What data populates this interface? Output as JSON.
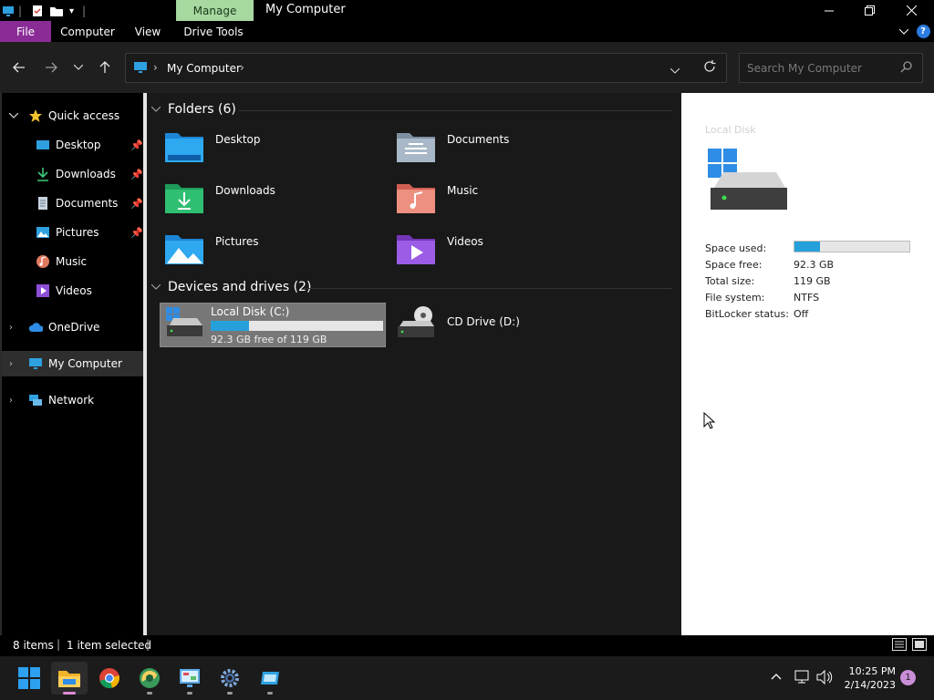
{
  "window": {
    "title": "My Computer",
    "contextual_tab": "Manage"
  },
  "ribbon": {
    "tabs": [
      "File",
      "Computer",
      "View",
      "Drive Tools"
    ]
  },
  "address": {
    "location": "My Computer",
    "search_placeholder": "Search My Computer"
  },
  "sidebar": {
    "quick_access": "Quick access",
    "items": [
      "Desktop",
      "Downloads",
      "Documents",
      "Pictures",
      "Music",
      "Videos"
    ],
    "onedrive": "OneDrive",
    "my_computer": "My Computer",
    "network": "Network"
  },
  "main": {
    "folders_header": "Folders (6)",
    "folders": [
      "Desktop",
      "Documents",
      "Downloads",
      "Music",
      "Pictures",
      "Videos"
    ],
    "devices_header": "Devices and drives (2)",
    "drive_c": {
      "name": "Local Disk (C:)",
      "free_text": "92.3 GB free of 119 GB",
      "used_fraction": 0.22
    },
    "drive_d": {
      "name": "CD Drive (D:)"
    }
  },
  "details": {
    "title": "Local Disk",
    "rows": [
      {
        "label": "Space used:",
        "value": ""
      },
      {
        "label": "Space free:",
        "value": "92.3 GB"
      },
      {
        "label": "Total size:",
        "value": "119 GB"
      },
      {
        "label": "File system:",
        "value": "NTFS"
      },
      {
        "label": "BitLocker status:",
        "value": "Off"
      }
    ],
    "used_fraction": 0.22
  },
  "status": {
    "items": "8 items",
    "selected": "1 item selected"
  },
  "taskbar": {
    "time": "10:25 PM",
    "date": "2/14/2023",
    "notifications": "1"
  },
  "colors": {
    "accent": "#26a0da",
    "file_tab": "#8a2c96",
    "manage_tab": "#a6d8a0"
  }
}
